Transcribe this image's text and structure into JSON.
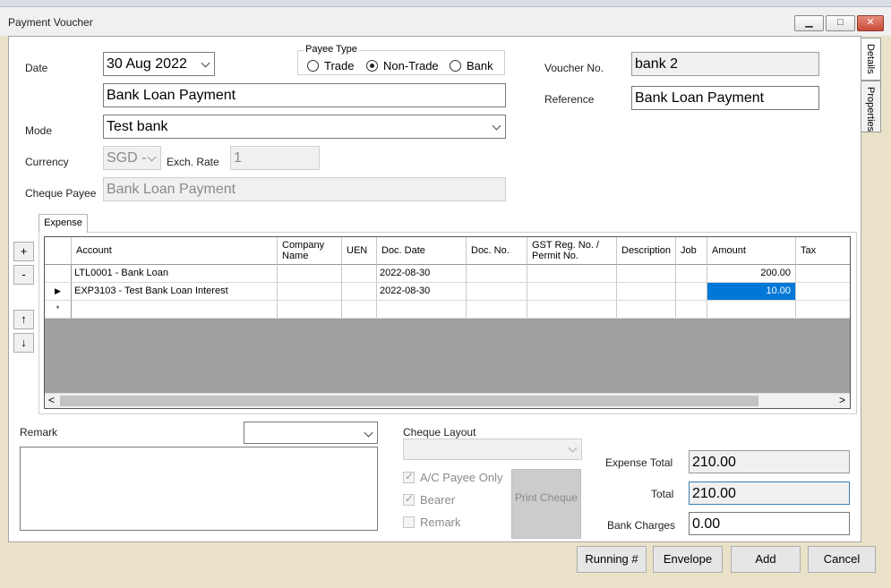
{
  "window": {
    "title": "Payment Voucher",
    "minimize_glyph": "▁",
    "maximize_glyph": "□",
    "close_glyph": "✕"
  },
  "side_tabs": {
    "details": "Details",
    "properties": "Properties"
  },
  "form": {
    "date_label": "Date",
    "date_value": "30 Aug 2022",
    "description_value": "Bank Loan Payment",
    "payee_type_label": "Payee Type",
    "payee_options": [
      "Trade",
      "Non-Trade",
      "Bank"
    ],
    "payee_selected": "Non-Trade",
    "mode_label": "Mode",
    "mode_value": "Test bank",
    "currency_label": "Currency",
    "currency_value": "SGD -",
    "exch_rate_label": "Exch. Rate",
    "exch_rate_value": "1",
    "cheque_payee_label": "Cheque Payee",
    "cheque_payee_value": "Bank Loan Payment",
    "voucher_no_label": "Voucher No.",
    "voucher_no_value": "bank 2",
    "reference_label": "Reference",
    "reference_value": "Bank Loan Payment"
  },
  "grid": {
    "tab_label": "Expense",
    "side_buttons": {
      "add": "+",
      "remove": "-",
      "up": "↑",
      "down": "↓"
    },
    "columns": [
      "Account",
      "Company Name",
      "UEN",
      "Doc. Date",
      "Doc. No.",
      "GST Reg. No. / Permit No.",
      "Description",
      "Job",
      "Amount",
      "Tax"
    ],
    "rows": [
      {
        "marker": "",
        "account": "LTL0001 - Bank Loan",
        "doc_date": "2022-08-30",
        "amount": "200.00"
      },
      {
        "marker": "▶",
        "account": "EXP3103 - Test Bank Loan Interest",
        "doc_date": "2022-08-30",
        "amount": "10.00"
      }
    ],
    "new_row_marker": "*",
    "scroll_left": "<",
    "scroll_right": ">"
  },
  "bottom": {
    "remark_label": "Remark",
    "cheque_layout_label": "Cheque Layout",
    "ac_payee_only_label": "A/C Payee Only",
    "ac_payee_only_checked": true,
    "bearer_label": "Bearer",
    "bearer_checked": true,
    "remark_check_label": "Remark",
    "remark_checked": false,
    "print_cheque_label": "Print Cheque",
    "expense_total_label": "Expense Total",
    "expense_total_value": "210.00",
    "total_label": "Total",
    "total_value": "210.00",
    "bank_charges_label": "Bank Charges",
    "bank_charges_value": "0.00"
  },
  "actions": {
    "running": "Running #",
    "envelope": "Envelope",
    "add": "Add",
    "cancel": "Cancel"
  }
}
